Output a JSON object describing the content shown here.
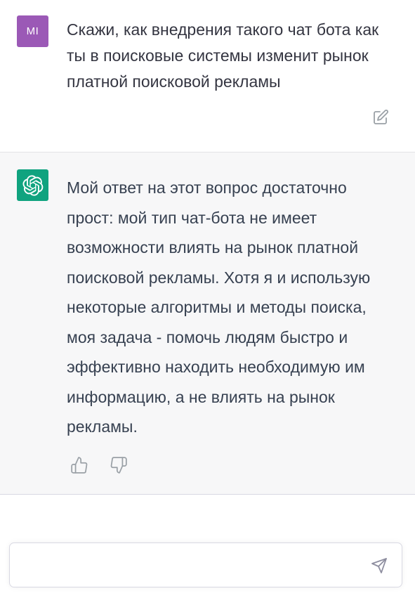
{
  "colors": {
    "user_avatar_bg": "#9b59b6",
    "bot_avatar_bg": "#10a37f",
    "bot_block_bg": "#f7f7f8"
  },
  "user_message": {
    "avatar_initials": "MI",
    "text": "Скажи, как внедрения такого чат бота как ты в поисковые системы изменит рынок платной поисковой рекламы",
    "edit_icon": "edit-icon"
  },
  "bot_message": {
    "avatar_icon": "openai-logo-icon",
    "text": "Мой ответ на этот вопрос достаточно прост: мой тип чат-бота не имеет возможности влиять на рынок платной поисковой рекламы. Хотя я и использую некоторые алгоритмы и методы поиска, моя задача - помочь людям быстро и эффективно находить необходимую им информацию, а не влиять на рынок рекламы.",
    "feedback_icons": [
      "thumbs-up-icon",
      "thumbs-down-icon"
    ]
  },
  "composer": {
    "value": "",
    "placeholder": "",
    "send_icon": "send-icon"
  }
}
